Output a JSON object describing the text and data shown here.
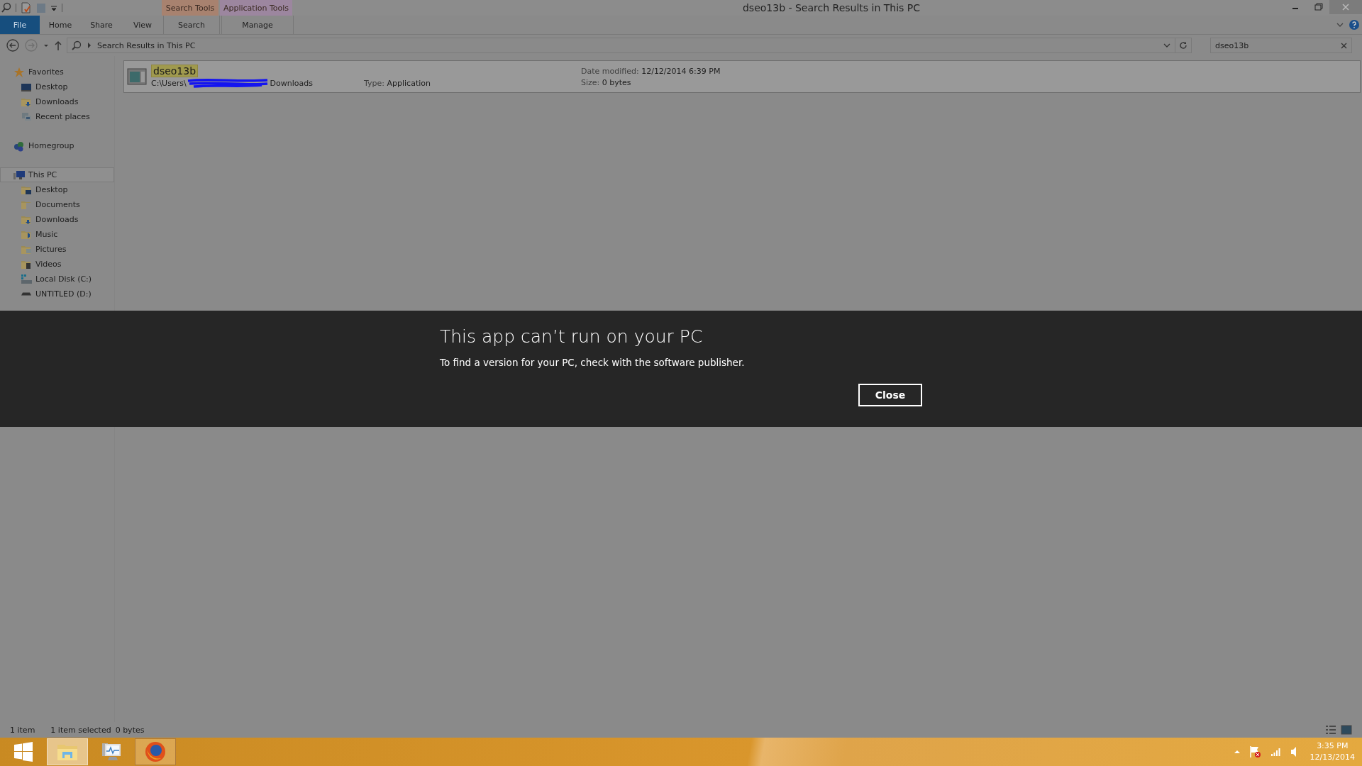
{
  "window": {
    "title": "dseo13b - Search Results in This PC"
  },
  "ribbon": {
    "tabs": [
      {
        "label": "File",
        "kind": "file"
      },
      {
        "label": "Home",
        "kind": "tab"
      },
      {
        "label": "Share",
        "kind": "tab"
      },
      {
        "label": "View",
        "kind": "tab"
      }
    ],
    "tab_groups": [
      {
        "label": "Search Tools",
        "color": "#a8826f",
        "tabs": [
          "Search"
        ]
      },
      {
        "label": "Application Tools",
        "color": "#9c869f",
        "tabs": [
          "Manage"
        ]
      }
    ]
  },
  "address_bar": {
    "path": "Search Results in This PC"
  },
  "search": {
    "value": "dseo13b"
  },
  "sidebar": {
    "items": [
      {
        "label": "Favorites",
        "kind": "star",
        "selected": false,
        "children": [
          {
            "label": "Desktop",
            "kind": "desktop",
            "selected": false
          },
          {
            "label": "Downloads",
            "kind": "downloads",
            "selected": false
          },
          {
            "label": "Recent places",
            "kind": "recent",
            "selected": false
          }
        ]
      },
      {
        "label": "Homegroup",
        "kind": "homegroup",
        "selected": false
      },
      {
        "label": "This PC",
        "kind": "computer",
        "selected": true,
        "children": [
          {
            "label": "Desktop",
            "kind": "desktop-folder",
            "selected": false
          },
          {
            "label": "Documents",
            "kind": "documents",
            "selected": false
          },
          {
            "label": "Downloads",
            "kind": "downloads",
            "selected": false
          },
          {
            "label": "Music",
            "kind": "music",
            "selected": false
          },
          {
            "label": "Pictures",
            "kind": "pictures",
            "selected": false
          },
          {
            "label": "Videos",
            "kind": "videos",
            "selected": false
          },
          {
            "label": "Local Disk (C:)",
            "kind": "disk",
            "selected": false
          },
          {
            "label": "UNTITLED (D:)",
            "kind": "drive",
            "selected": false
          }
        ]
      }
    ]
  },
  "results": [
    {
      "name": "dseo13b",
      "path_start": "C:\\Users\\",
      "path_end": "Downloads",
      "type_label": "Type:",
      "type": "Application",
      "date_label": "Date modified:",
      "date": "12/12/2014 6:39 PM",
      "size_label": "Size:",
      "size": "0 bytes",
      "selected": true
    }
  ],
  "dialog": {
    "title": "This app can’t run on your PC",
    "message": "To find a version for your PC, check with the software publisher.",
    "button": "Close"
  },
  "status_bar": {
    "count": "1 item",
    "selection": "1 item selected",
    "size": "0 bytes"
  },
  "taskbar": {
    "apps": [
      {
        "kind": "start",
        "active": false,
        "running": false
      },
      {
        "kind": "explorer",
        "active": true,
        "running": true
      },
      {
        "kind": "monitor",
        "active": false,
        "running": false
      },
      {
        "kind": "browser",
        "active": false,
        "running": true
      }
    ],
    "time": "3:35 PM",
    "date": "12/13/2014"
  }
}
